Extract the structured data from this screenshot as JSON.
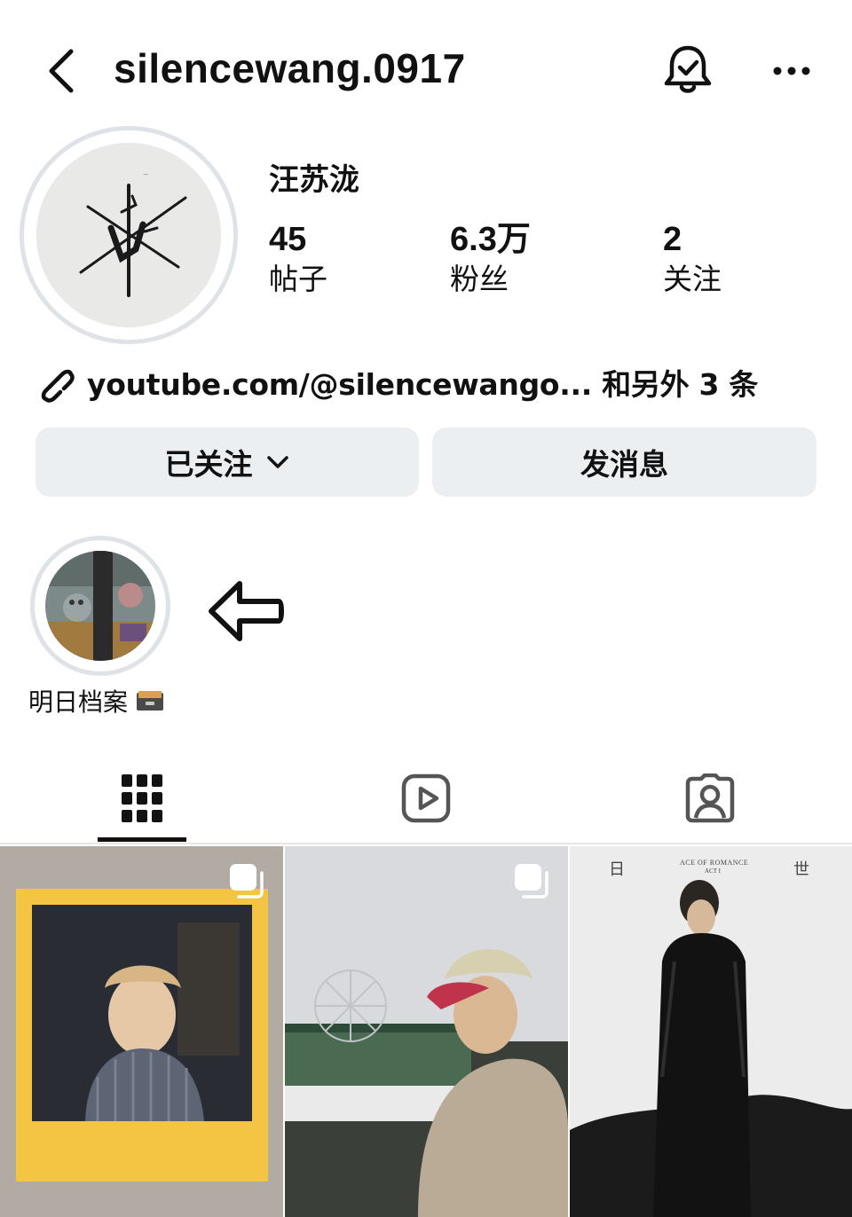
{
  "header": {
    "username": "silencewang.0917"
  },
  "profile": {
    "full_name": "汪苏泷",
    "stats": [
      {
        "value": "45",
        "label": "帖子"
      },
      {
        "value": "6.3万",
        "label": "粉丝"
      },
      {
        "value": "2",
        "label": "关注"
      }
    ],
    "link_text": "youtube.com/@silencewango... 和另外 3 条"
  },
  "actions": {
    "following_label": "已关注",
    "message_label": "发消息"
  },
  "highlights": [
    {
      "label": "明日档案"
    }
  ],
  "tabs": [
    {
      "icon": "grid-icon",
      "active": true
    },
    {
      "icon": "reels-icon",
      "active": false
    },
    {
      "icon": "tagged-icon",
      "active": false
    }
  ],
  "posts": [
    {
      "type": "carousel"
    },
    {
      "type": "carousel"
    },
    {
      "type": "single",
      "poster_left_mark": "日",
      "poster_right_mark": "世",
      "poster_title": "ACE OF ROMANCE",
      "poster_subtitle": "ACT I"
    }
  ]
}
